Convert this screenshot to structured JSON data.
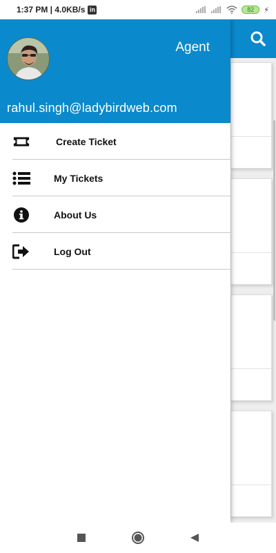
{
  "status_bar": {
    "time_speed": "1:37 PM | 4.0KB/s",
    "linkedin_icon": "in",
    "battery": "82"
  },
  "drawer": {
    "role": "Agent",
    "email": "rahul.singh@ladybirdweb.com",
    "items": [
      {
        "label": "Create Ticket",
        "icon": "ticket-icon"
      },
      {
        "label": "My Tickets",
        "icon": "list-icon"
      },
      {
        "label": "About Us",
        "icon": "info-icon"
      },
      {
        "label": "Log Out",
        "icon": "logout-icon"
      }
    ]
  },
  "colors": {
    "primary": "#0a89cc",
    "drawer_bg": "#ffffff"
  }
}
